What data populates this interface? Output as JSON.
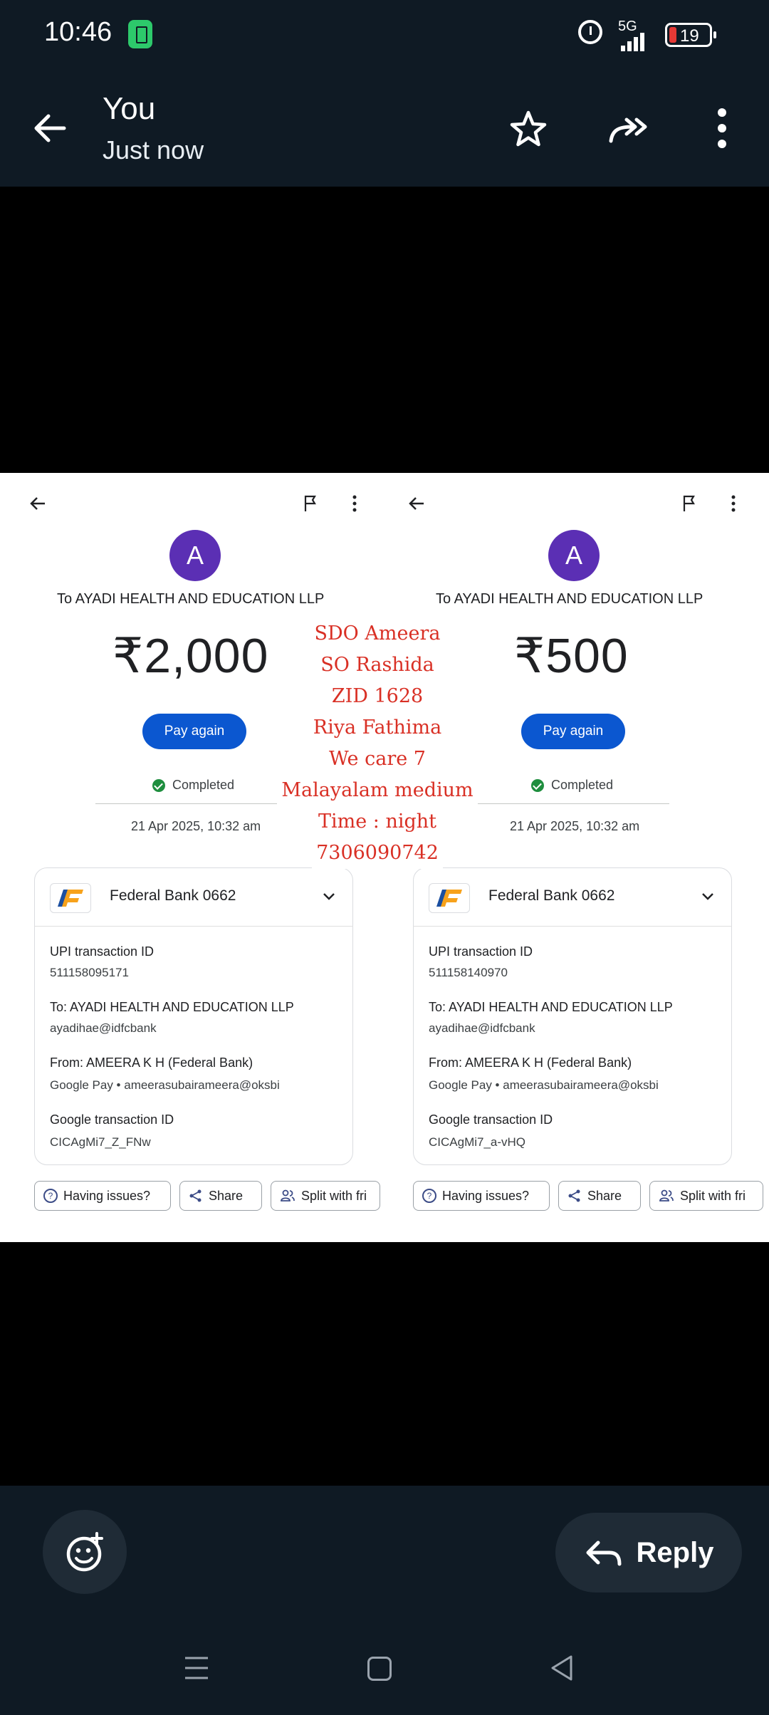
{
  "status_bar": {
    "time": "10:46",
    "network": "5G",
    "battery": "19"
  },
  "header": {
    "sender": "You",
    "subtitle": "Just now"
  },
  "receipts": [
    {
      "avatar_letter": "A",
      "payee": "To AYADI HEALTH AND EDUCATION LLP",
      "amount": "₹2,000",
      "pay_again": "Pay again",
      "status": "Completed",
      "datetime": "21 Apr 2025, 10:32 am",
      "bank": "Federal Bank 0662",
      "upi_label": "UPI transaction ID",
      "upi_id": "511158095171",
      "to_label": "To: AYADI HEALTH AND EDUCATION LLP",
      "to_value": "ayadihae@idfcbank",
      "from_label": "From: AMEERA K H (Federal Bank)",
      "from_value": "Google Pay • ameerasubairameera@oksbi",
      "gtid_label": "Google transaction ID",
      "gtid": "CICAgMi7_Z_FNw",
      "chips": {
        "issues": "Having issues?",
        "share": "Share",
        "split": "Split with fri"
      }
    },
    {
      "avatar_letter": "A",
      "payee": "To AYADI HEALTH AND EDUCATION LLP",
      "amount": "₹500",
      "pay_again": "Pay again",
      "status": "Completed",
      "datetime": "21 Apr 2025, 10:32 am",
      "bank": "Federal Bank 0662",
      "upi_label": "UPI transaction ID",
      "upi_id": "511158140970",
      "to_label": "To: AYADI HEALTH AND EDUCATION LLP",
      "to_value": "ayadihae@idfcbank",
      "from_label": "From: AMEERA K H (Federal Bank)",
      "from_value": "Google Pay • ameerasubairameera@oksbi",
      "gtid_label": "Google transaction ID",
      "gtid": "CICAgMi7_a-vHQ",
      "chips": {
        "issues": "Having issues?",
        "share": "Share",
        "split": "Split with fri"
      }
    }
  ],
  "overlay_lines": [
    "SDO Ameera",
    "SO Rashida",
    "ZID 1628",
    "Riya Fathima",
    "We care 7",
    "Malayalam medium",
    "Time : night",
    "7306090742"
  ],
  "reply_label": "Reply",
  "colors": {
    "bar": "#0f1a24",
    "accent_blue": "#0b57d0",
    "avatar": "#5b2fb4",
    "overlay_text": "#d93025"
  }
}
